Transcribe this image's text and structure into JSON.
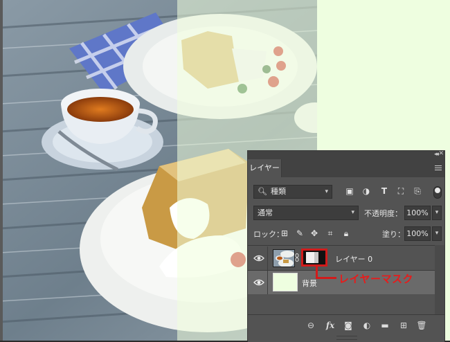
{
  "panel": {
    "collapse_icon": "double-chevron-right-icon",
    "close_icon": "close-icon",
    "tab_label": "レイヤー",
    "menu_icon": "hamburger-menu-icon",
    "filter": {
      "search_icon": "search-icon",
      "value": "種類",
      "icons": [
        "image-filter-icon",
        "adjustment-filter-icon",
        "type-filter-icon",
        "shape-filter-icon",
        "smart-object-filter-icon"
      ],
      "toggle": "filter-toggle"
    },
    "blend_mode": "通常",
    "opacity_label": "不透明度：",
    "opacity_value": "100%",
    "lock_label": "ロック：",
    "lock_icons": [
      "lock-transparent-icon",
      "lock-image-icon",
      "lock-position-icon",
      "lock-artboard-icon",
      "lock-all-icon"
    ],
    "fill_label": "塗り：",
    "fill_value": "100%",
    "layers": [
      {
        "name": "レイヤー 0",
        "visible": true,
        "has_mask": true,
        "selected": false
      },
      {
        "name": "背景",
        "visible": true,
        "has_mask": false,
        "selected": true
      }
    ],
    "footer_icons": [
      "link-layers-icon",
      "fx-icon",
      "add-mask-icon",
      "adjustment-layer-icon",
      "new-group-icon",
      "new-layer-icon",
      "trash-icon"
    ]
  },
  "annotation": {
    "label": "レイヤーマスク",
    "color": "#e81b1b"
  },
  "colors": {
    "mask_fill": "#eefee0",
    "panel_bg": "#535353",
    "selected_row": "#6a6a6a"
  }
}
